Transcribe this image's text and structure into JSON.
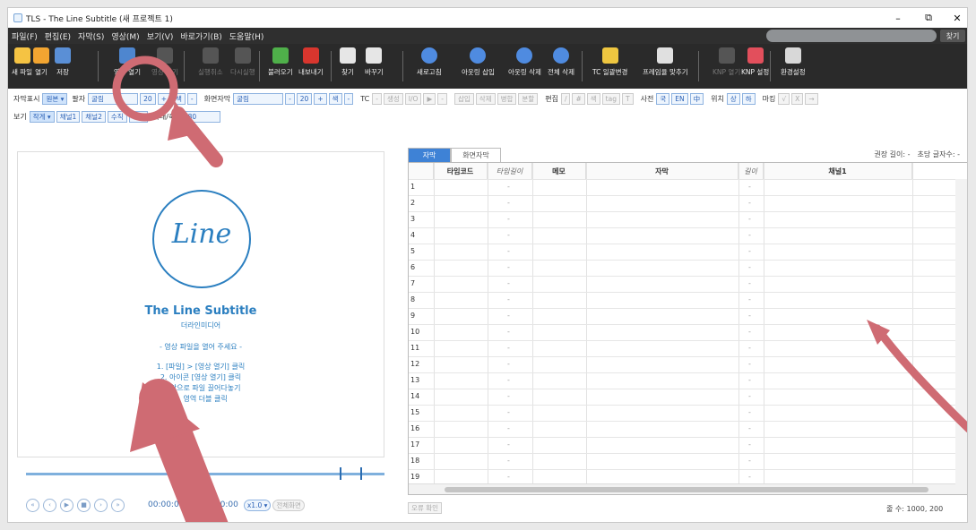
{
  "window": {
    "title": "TLS - The Line Subtitle (새 프로젝트 1)",
    "minimize": "–",
    "restore": "⧉",
    "close": "✕"
  },
  "menu": [
    "파일(F)",
    "편집(E)",
    "자막(S)",
    "영상(M)",
    "보기(V)",
    "바로가기(B)",
    "도움말(H)"
  ],
  "search": {
    "button": "찾기"
  },
  "toolbar": [
    {
      "label": "새 파일",
      "icon": "new-file-icon",
      "color": "#f5c343"
    },
    {
      "label": "열기",
      "icon": "open-folder-icon",
      "color": "#f2a531"
    },
    {
      "label": "저장",
      "icon": "save-icon",
      "color": "#5a8fd6"
    },
    {
      "label": "영상 열기",
      "icon": "video-open-icon",
      "color": "#4e86cf"
    },
    {
      "label": "영상 닫기",
      "icon": "video-close-icon",
      "color": "#4a76b3"
    },
    {
      "label": "실행취소",
      "icon": "undo-icon",
      "color": "#4d78b5"
    },
    {
      "label": "다시실행",
      "icon": "redo-icon",
      "color": "#4d78b5"
    },
    {
      "label": "불러오기",
      "icon": "import-icon",
      "color": "#4fb04a"
    },
    {
      "label": "내보내기",
      "icon": "export-icon",
      "color": "#d8362e"
    },
    {
      "label": "찾기",
      "icon": "find-icon",
      "color": "#e6e6e6"
    },
    {
      "label": "바꾸기",
      "icon": "replace-icon",
      "color": "#e6e6e6"
    },
    {
      "label": "새로고침",
      "icon": "refresh-icon",
      "color": "#4f8be0"
    },
    {
      "label": "아웃링 삽입",
      "icon": "outline-insert-icon",
      "color": "#4f8be0"
    },
    {
      "label": "아웃링 삭제",
      "icon": "outline-delete-icon",
      "color": "#4f8be0"
    },
    {
      "label": "전체 삭제",
      "icon": "delete-all-icon",
      "color": "#4f8be0"
    },
    {
      "label": "TC 일괄변경",
      "icon": "tc-change-icon",
      "color": "#eec640"
    },
    {
      "label": "프레임율 맞추기",
      "icon": "frame-rate-icon",
      "color": "#e0e0e0"
    },
    {
      "label": "KNP 열기",
      "icon": "knp-open-icon",
      "color": "#6a8a5a"
    },
    {
      "label": "KNP 설정",
      "icon": "knp-settings-icon",
      "color": "#e24f5c"
    },
    {
      "label": "환경설정",
      "icon": "settings-icon",
      "color": "#d8d8d8"
    }
  ],
  "options": {
    "row1": {
      "subtitle_display_label": "자막표시",
      "subtitle_display_value": "원본 ▾",
      "font_label": "팔자",
      "font_value": "굴림",
      "size_value": "20",
      "plus": "+",
      "color_label": "색",
      "minus": "-",
      "screen_sub_label": "화면자막",
      "screen_font": "굴림",
      "screen_size": "20",
      "tc_label": "TC",
      "tc_buttons": [
        "-",
        "생성",
        "I/O",
        "▶",
        "-"
      ],
      "action_buttons": [
        "삽입",
        "삭제",
        "병합",
        "분할"
      ],
      "edit_label": "편집",
      "edit_buttons": [
        "/",
        "#",
        "색",
        "tag",
        "T"
      ],
      "dict_label": "사전",
      "dict_buttons": [
        "국",
        "EN",
        "中"
      ],
      "pos_label": "위치",
      "pos_buttons": [
        "상",
        "하"
      ],
      "marking_label": "마킹",
      "marking_buttons": [
        "√",
        "X",
        "→"
      ]
    },
    "row2": {
      "view_label": "보기",
      "view_value": "작게 ▾",
      "ch_buttons": [
        "채널1",
        "채널2",
        "수직",
        "파형"
      ],
      "zoom_label": "확대/축소",
      "zoom_value": "80"
    }
  },
  "preview": {
    "logo_text": "Line",
    "title": "The Line Subtitle",
    "subtitle": "더라인미디어",
    "hint": "- 영상 파일을 열어 주세요 -",
    "steps": [
      "1. [파일] > [영상 열기] 클릭",
      "2. 아이콘 [영상 열기] 클릭",
      "3. 창으로 파일 끌어다놓기",
      "4. 영역 더블 클릭"
    ]
  },
  "playback": {
    "time_start": "00:00:00",
    "time_end": "00:00:00",
    "speed": "x1.0 ▾",
    "fullscreen": "전체화면"
  },
  "grid": {
    "tabs": [
      "자막",
      "화면자막"
    ],
    "recommend_label": "권장 길이: -",
    "cps_label": "초당 글자수: -",
    "headers": [
      "타임코드",
      "타임길이",
      "메모",
      "자막",
      "길이",
      "채널1"
    ],
    "rows": [
      "1",
      "2",
      "3",
      "4",
      "5",
      "6",
      "7",
      "8",
      "9",
      "10",
      "11",
      "12",
      "13",
      "14",
      "15",
      "16",
      "17",
      "18",
      "19"
    ],
    "dash": "-",
    "error_button": "오류 확인",
    "count_label": "줄 수: 1000, 200"
  },
  "annotations": {
    "arrow_color": "#cf6b73"
  }
}
